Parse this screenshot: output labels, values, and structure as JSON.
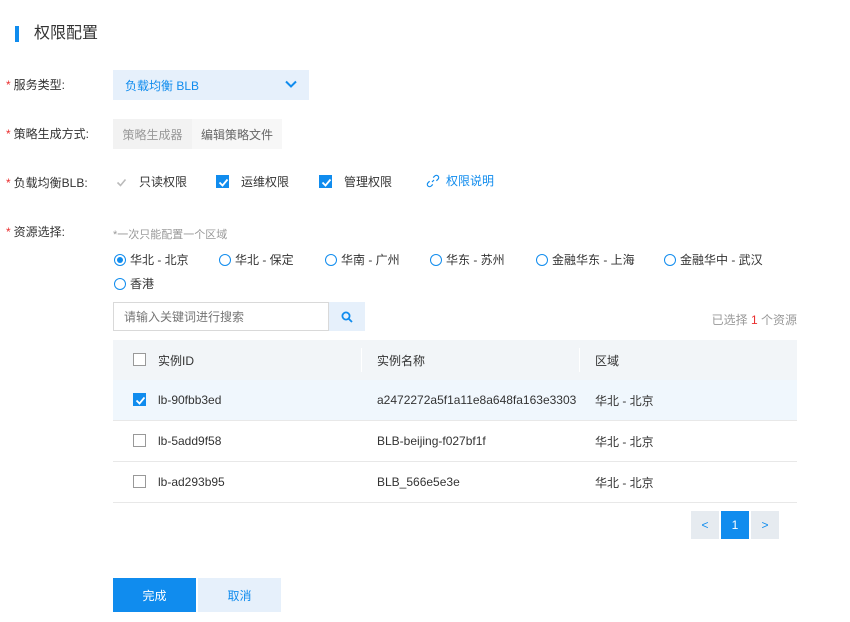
{
  "section_title": "权限配置",
  "service": {
    "label": "服务类型:",
    "selected": "负载均衡 BLB"
  },
  "policy": {
    "label": "策略生成方式:",
    "options": [
      "策略生成器",
      "编辑策略文件"
    ]
  },
  "permissions": {
    "label": "负载均衡BLB:",
    "items": [
      {
        "label": "只读权限",
        "state": "checked-disabled"
      },
      {
        "label": "运维权限",
        "state": "checked"
      },
      {
        "label": "管理权限",
        "state": "checked"
      }
    ],
    "help_link": "权限说明"
  },
  "resource": {
    "label": "资源选择:",
    "hint": "*一次只能配置一个区域",
    "regions": [
      "华北 - 北京",
      "华北 - 保定",
      "华南 - 广州",
      "华东 - 苏州",
      "金融华东 - 上海",
      "金融华中 - 武汉",
      "香港"
    ],
    "selected_region": "华北 - 北京",
    "search_placeholder": "请输入关键词进行搜索",
    "selected_prefix": "已选择",
    "selected_count": "1",
    "selected_suffix": "个资源"
  },
  "table": {
    "columns": [
      "实例ID",
      "实例名称",
      "区域"
    ],
    "rows": [
      {
        "id": "lb-90fbb3ed",
        "name": "a2472272a5f1a11e8a648fa163e3303",
        "region": "华北 - 北京",
        "checked": true
      },
      {
        "id": "lb-5add9f58",
        "name": "BLB-beijing-f027bf1f",
        "region": "华北 - 北京",
        "checked": false
      },
      {
        "id": "lb-ad293b95",
        "name": "BLB_566e5e3e",
        "region": "华北 - 北京",
        "checked": false
      }
    ]
  },
  "pagination": {
    "prev": "<",
    "current": "1",
    "next": ">"
  },
  "actions": {
    "confirm": "完成",
    "cancel": "取消"
  },
  "colors": {
    "accent": "#108cee",
    "required": "#ea2e2e"
  }
}
